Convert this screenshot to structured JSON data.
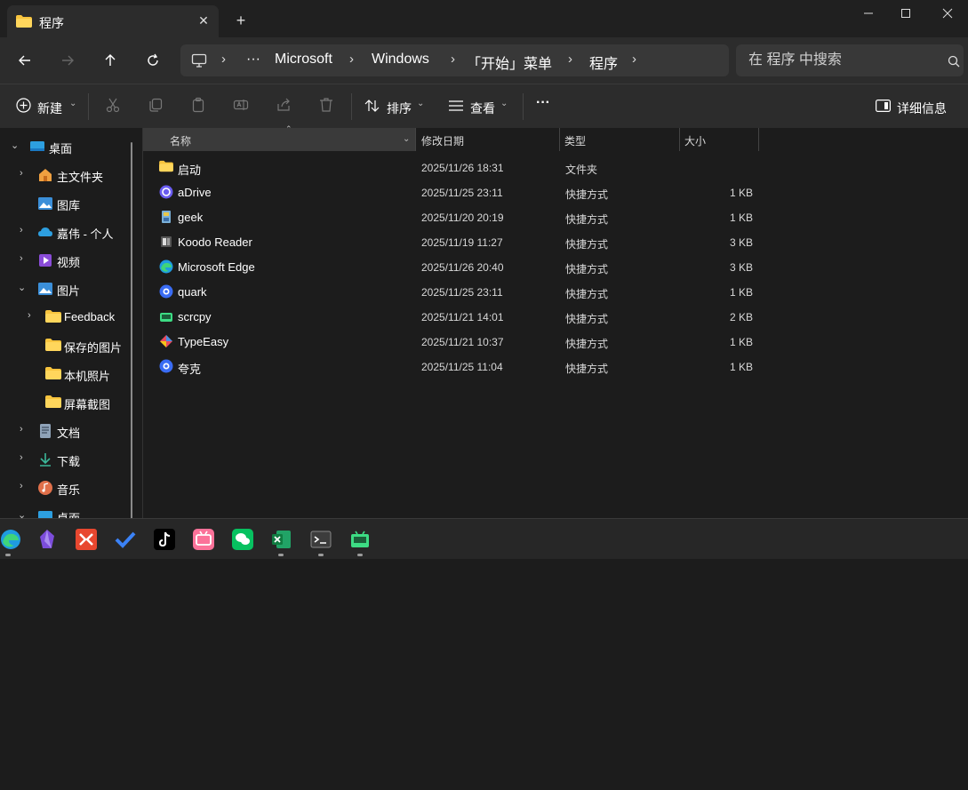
{
  "window": {
    "tab_title": "程序",
    "tab_close": "✕",
    "new_tab": "+",
    "minimize": "—",
    "maximize": "☐",
    "close": "✕"
  },
  "address": {
    "ellipsis": "···",
    "crumbs": [
      "Microsoft",
      "Windows",
      "「开始」菜单",
      "程序"
    ],
    "search_placeholder": "在 程序 中搜索"
  },
  "toolbar": {
    "new_label": "新建",
    "sort_label": "排序",
    "view_label": "查看",
    "more_label": "···",
    "details_label": "详细信息"
  },
  "sidebar": {
    "items": [
      {
        "label": "桌面",
        "icon": "desktop-icon"
      },
      {
        "label": "主文件夹",
        "icon": "home-icon"
      },
      {
        "label": "图库",
        "icon": "gallery-icon"
      },
      {
        "label": "嘉伟 - 个人",
        "icon": "onedrive-icon"
      },
      {
        "label": "视频",
        "icon": "videos-icon"
      },
      {
        "label": "图片",
        "icon": "pictures-icon"
      },
      {
        "label": "Feedback",
        "icon": "folder-icon"
      },
      {
        "label": "保存的图片",
        "icon": "folder-icon"
      },
      {
        "label": "本机照片",
        "icon": "folder-icon"
      },
      {
        "label": "屏幕截图",
        "icon": "folder-icon"
      },
      {
        "label": "文档",
        "icon": "documents-icon"
      },
      {
        "label": "下载",
        "icon": "downloads-icon"
      },
      {
        "label": "音乐",
        "icon": "music-icon"
      },
      {
        "label": "桌面",
        "icon": "desktop-icon"
      }
    ]
  },
  "columns": {
    "name": "名称",
    "modified": "修改日期",
    "type": "类型",
    "size": "大小"
  },
  "files": [
    {
      "name": "启动",
      "date": "2025/11/26 18:31",
      "type": "文件夹",
      "size": "",
      "icon": "folder-icon"
    },
    {
      "name": "aDrive",
      "date": "2025/11/25 23:11",
      "type": "快捷方式",
      "size": "1 KB",
      "icon": "adrive-icon"
    },
    {
      "name": "geek",
      "date": "2025/11/20 20:19",
      "type": "快捷方式",
      "size": "1 KB",
      "icon": "geek-icon"
    },
    {
      "name": "Koodo Reader",
      "date": "2025/11/19 11:27",
      "type": "快捷方式",
      "size": "3 KB",
      "icon": "koodo-reader-icon"
    },
    {
      "name": "Microsoft Edge",
      "date": "2025/11/26 20:40",
      "type": "快捷方式",
      "size": "3 KB",
      "icon": "edge-icon"
    },
    {
      "name": "quark",
      "date": "2025/11/25 23:11",
      "type": "快捷方式",
      "size": "1 KB",
      "icon": "quark-icon"
    },
    {
      "name": "scrcpy",
      "date": "2025/11/21 14:01",
      "type": "快捷方式",
      "size": "2 KB",
      "icon": "scrcpy-icon"
    },
    {
      "name": "TypeEasy",
      "date": "2025/11/21 10:37",
      "type": "快捷方式",
      "size": "1 KB",
      "icon": "typeeasy-icon"
    },
    {
      "name": "夸克",
      "date": "2025/11/25 11:04",
      "type": "快捷方式",
      "size": "1 KB",
      "icon": "quark-icon"
    }
  ],
  "taskbar": {
    "apps": [
      "edge-icon",
      "obsidian-icon",
      "xmind-icon",
      "todo-icon",
      "tiktok-icon",
      "bilibili-icon",
      "wechat-icon",
      "excel-icon",
      "terminal-icon",
      "android-icon"
    ]
  },
  "colors": {
    "accent": "#4cc2ff",
    "folder": "#f8c43e",
    "window_bg": "#1c1c1c",
    "bar_bg": "#2c2c2c"
  }
}
